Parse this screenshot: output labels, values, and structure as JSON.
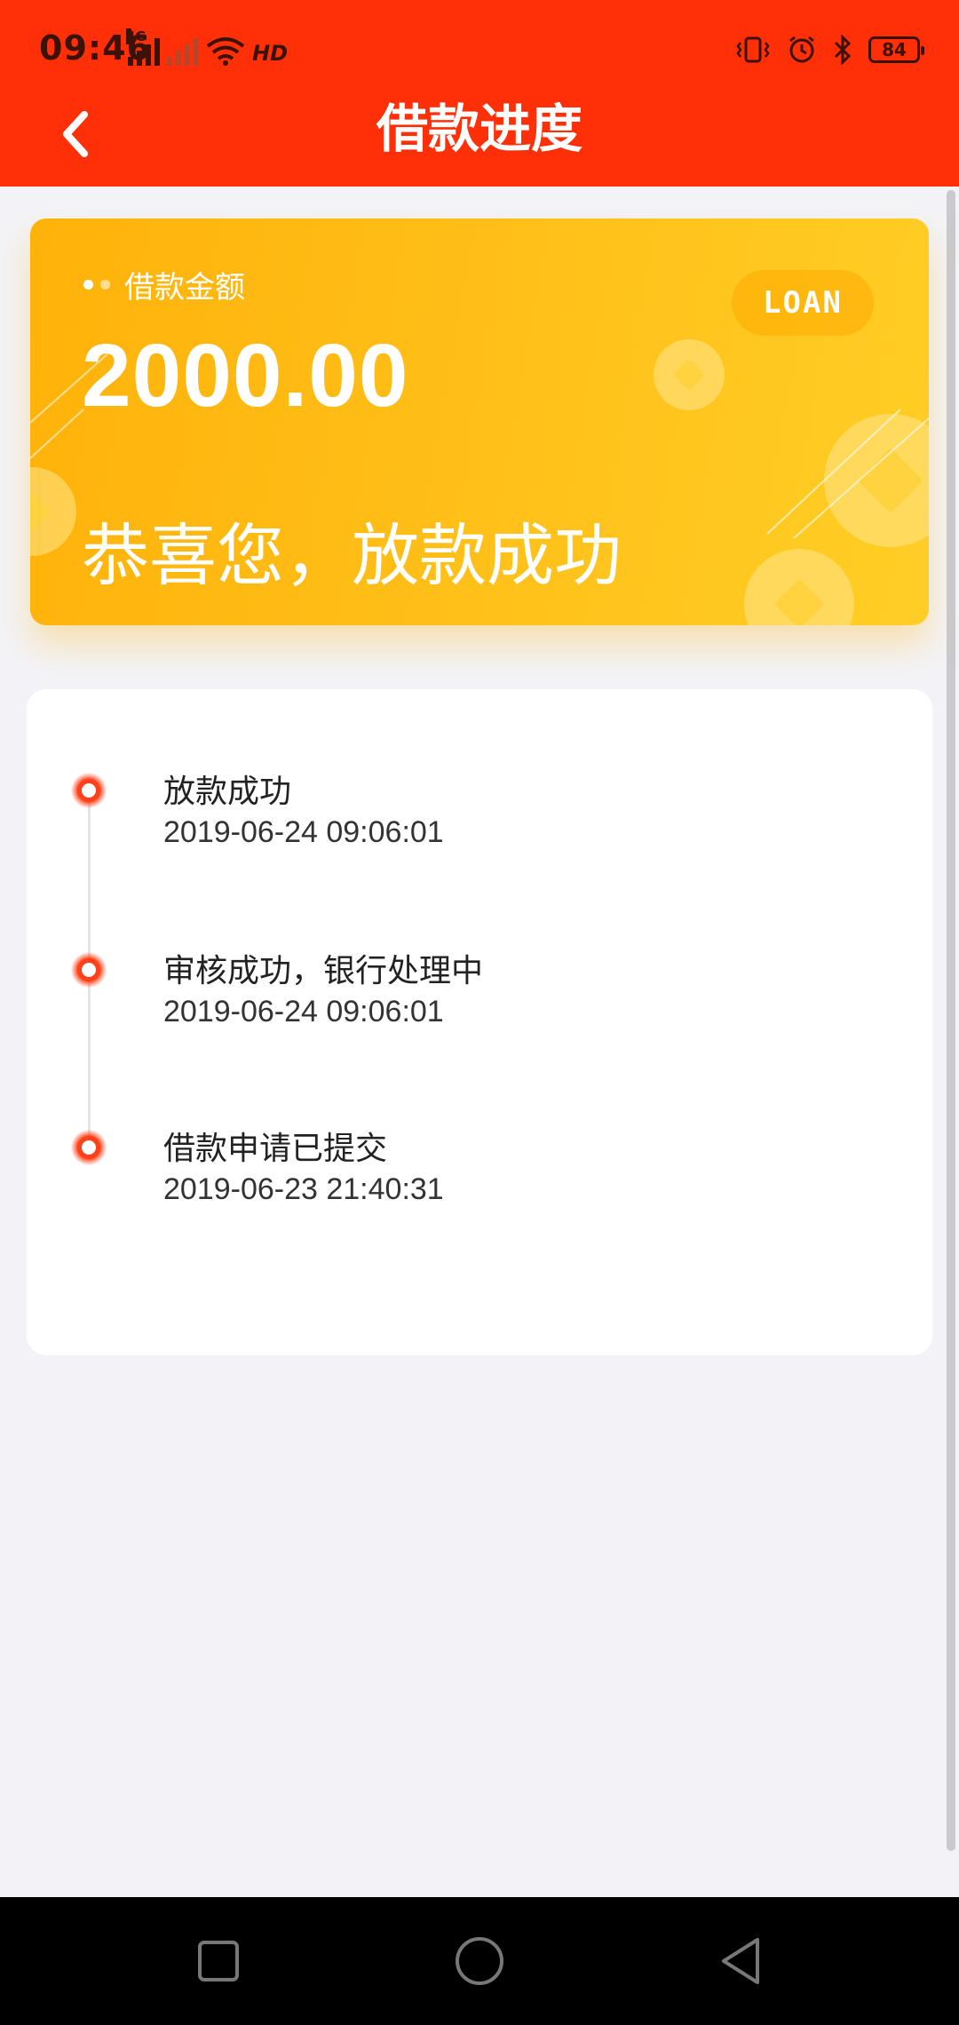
{
  "status_bar": {
    "time": "09:46",
    "network_tag": "4G",
    "hd_label": "HD",
    "battery": "84",
    "icons": [
      "signal-icon",
      "signal-off-icon",
      "wifi-icon",
      "hd-icon",
      "vibrate-icon",
      "alarm-icon",
      "bluetooth-icon",
      "battery-icon"
    ]
  },
  "header": {
    "title": "借款进度",
    "back_icon": "chevron-left-icon"
  },
  "loan_card": {
    "label": "借款金额",
    "amount": "2000.00",
    "status": "恭喜您，放款成功",
    "badge": "LOAN"
  },
  "timeline": {
    "items": [
      {
        "title": "放款成功",
        "time": "2019-06-24 09:06:01"
      },
      {
        "title": "审核成功，银行处理中",
        "time": "2019-06-24 09:06:01"
      },
      {
        "title": "借款申请已提交",
        "time": "2019-06-23 21:40:31"
      }
    ]
  },
  "system_nav": {
    "icons": [
      "recent-apps-icon",
      "home-icon",
      "back-icon"
    ]
  },
  "colors": {
    "header": "#ff3008",
    "card_gradient_start": "#ffb20a",
    "card_gradient_end": "#ffce26",
    "timeline_dot": "#ff4018",
    "background": "#f3f3f7"
  }
}
